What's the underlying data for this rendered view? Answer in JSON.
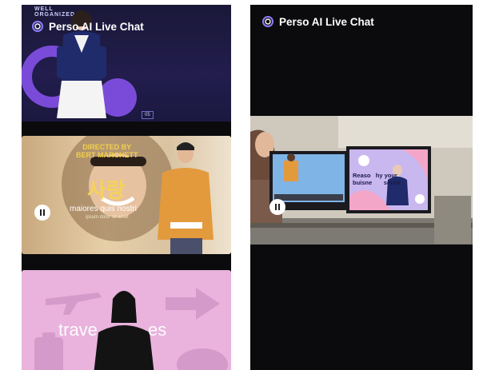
{
  "left_phone": {
    "brand_title": "Perso AI Live Chat",
    "cards": [
      {
        "top_text": "WELL\nORGANIZED",
        "page_number": "05"
      },
      {
        "director_text": "DIRECTED BY\nBERT MARCHETT",
        "korean_text": "사랑",
        "caption": "maiores quis nostri",
        "small_caption": "ipsum dolor sit amet"
      },
      {
        "big_text_left": "trave",
        "big_text_right": "es"
      }
    ]
  },
  "right_phone": {
    "brand_title": "Perso AI Live Chat",
    "screen_text": "Reaso   hy your\nbuisne       social"
  },
  "colors": {
    "phone_bg": "#0b0b0d",
    "accent_purple": "#7a4bd8",
    "accent_yellow": "#f5d25a",
    "pink": "#e9b3dd"
  },
  "icons": [
    "perso-logo-icon",
    "pause-icon",
    "airplane-icon",
    "arrow-icon",
    "suitcase-icon"
  ]
}
